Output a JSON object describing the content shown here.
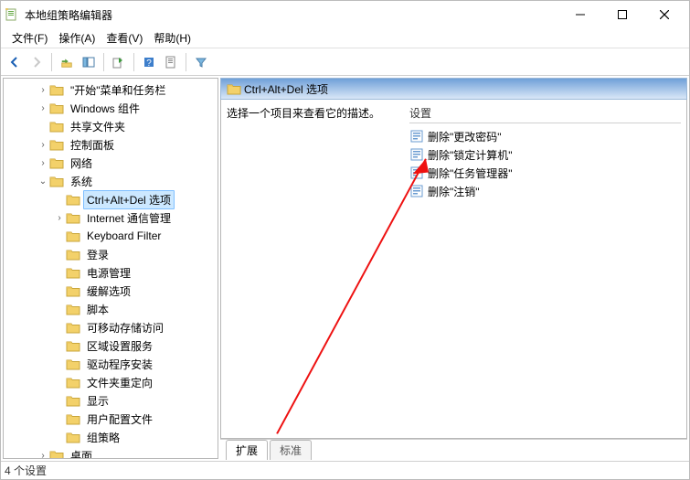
{
  "window": {
    "title": "本地组策略编辑器"
  },
  "menu": {
    "file": "文件(F)",
    "action": "操作(A)",
    "view": "查看(V)",
    "help": "帮助(H)"
  },
  "tree": {
    "items": [
      {
        "label": "\"开始\"菜单和任务栏",
        "depth": 2,
        "expand": ">"
      },
      {
        "label": "Windows 组件",
        "depth": 2,
        "expand": ">"
      },
      {
        "label": "共享文件夹",
        "depth": 2,
        "expand": ""
      },
      {
        "label": "控制面板",
        "depth": 2,
        "expand": ">"
      },
      {
        "label": "网络",
        "depth": 2,
        "expand": ">"
      },
      {
        "label": "系统",
        "depth": 2,
        "expand": "v"
      },
      {
        "label": "Ctrl+Alt+Del 选项",
        "depth": 3,
        "expand": "",
        "selected": true
      },
      {
        "label": "Internet 通信管理",
        "depth": 3,
        "expand": ">"
      },
      {
        "label": "Keyboard Filter",
        "depth": 3,
        "expand": ""
      },
      {
        "label": "登录",
        "depth": 3,
        "expand": ""
      },
      {
        "label": "电源管理",
        "depth": 3,
        "expand": ""
      },
      {
        "label": "缓解选项",
        "depth": 3,
        "expand": ""
      },
      {
        "label": "脚本",
        "depth": 3,
        "expand": ""
      },
      {
        "label": "可移动存储访问",
        "depth": 3,
        "expand": ""
      },
      {
        "label": "区域设置服务",
        "depth": 3,
        "expand": ""
      },
      {
        "label": "驱动程序安装",
        "depth": 3,
        "expand": ""
      },
      {
        "label": "文件夹重定向",
        "depth": 3,
        "expand": ""
      },
      {
        "label": "显示",
        "depth": 3,
        "expand": ""
      },
      {
        "label": "用户配置文件",
        "depth": 3,
        "expand": ""
      },
      {
        "label": "组策略",
        "depth": 3,
        "expand": ""
      },
      {
        "label": "桌面",
        "depth": 2,
        "expand": ">"
      }
    ]
  },
  "details": {
    "header": "Ctrl+Alt+Del 选项",
    "desc_hint": "选择一个项目来查看它的描述。",
    "settings_header": "设置",
    "settings": [
      {
        "label": "删除\"更改密码\""
      },
      {
        "label": "删除\"锁定计算机\""
      },
      {
        "label": "删除\"任务管理器\""
      },
      {
        "label": "删除\"注销\""
      }
    ]
  },
  "tabs": {
    "extended": "扩展",
    "standard": "标准"
  },
  "status": {
    "text": "4 个设置"
  }
}
